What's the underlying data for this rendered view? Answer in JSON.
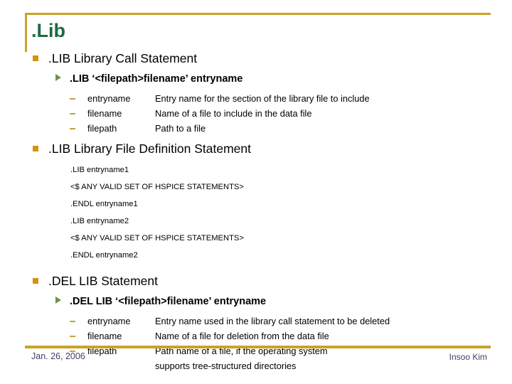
{
  "slide": {
    "title": ".Lib",
    "accent_color": "#c9a227",
    "title_color": "#1b6b45",
    "bullet_square_color": "#d4930d",
    "bullet_arrow_color": "#6f8f4a",
    "bullet_dash_color": "#c4a24a",
    "footer_text_color": "#3f3f6b"
  },
  "sections": [
    {
      "heading": ".LIB Library Call Statement",
      "syntax": ".LIB ‘<filepath>filename’ entryname",
      "params": [
        {
          "term": "entryname",
          "desc": "Entry name for the section of the library file to include"
        },
        {
          "term": "filename",
          "desc": "Name of a file to include in the data file"
        },
        {
          "term": "filepath",
          "desc": "Path to a file"
        }
      ]
    },
    {
      "heading": ".LIB Library File Definition Statement",
      "code": [
        ".LIB  entryname1",
        "<$ ANY VALID SET OF HSPICE STATEMENTS>",
        ".ENDL entryname1",
        ".LIB  entryname2",
        "<$ ANY VALID SET OF HSPICE STATEMENTS>",
        ".ENDL entryname2"
      ]
    },
    {
      "heading": ".DEL LIB Statement",
      "syntax": ".DEL LIB ‘<filepath>filename’ entryname",
      "params": [
        {
          "term": "entryname",
          "desc": "Entry name used in the library call statement to be deleted"
        },
        {
          "term": "filename",
          "desc": "Name of a file for deletion from the data file"
        },
        {
          "term": "filepath",
          "desc": "Path name of a file, if the operating system",
          "desc2": "supports tree-structured directories"
        }
      ]
    }
  ],
  "footer": {
    "date": "Jan. 26, 2006",
    "author": "Insoo Kim"
  }
}
